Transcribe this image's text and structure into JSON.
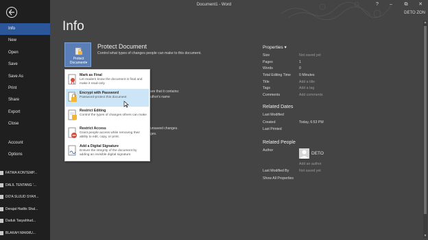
{
  "window": {
    "title": "Document1 - Word",
    "user": "DETO ZON",
    "controls": {
      "help": "?",
      "minimize": "–",
      "restore": "⧉",
      "close": "✕"
    }
  },
  "sidebar": {
    "items": [
      {
        "label": "Info"
      },
      {
        "label": "New"
      },
      {
        "label": "Open"
      },
      {
        "label": "Save"
      },
      {
        "label": "Save As"
      },
      {
        "label": "Print"
      },
      {
        "label": "Share"
      },
      {
        "label": "Export"
      },
      {
        "label": "Close"
      },
      {
        "label": "Account"
      },
      {
        "label": "Options"
      }
    ],
    "recent": [
      {
        "label": "FATWA KONTEMP..."
      },
      {
        "label": "DALIL TENTANG '..."
      },
      {
        "label": "DO'A SUJUD SYAH..."
      },
      {
        "label": "Derajat Hadits Shal..."
      },
      {
        "label": "Duduk Tasyahhud..."
      },
      {
        "label": "BLAKAH MAKMU..."
      }
    ]
  },
  "main": {
    "title": "Info",
    "protect": {
      "button_line1": "Protect",
      "button_line2": "Document",
      "caret": "▾",
      "title": "Protect Document",
      "description": "Control what types of changes people can make to this document."
    },
    "menu": [
      {
        "title": "Mark as Final",
        "desc": "Let readers know the document is final and make it read-only"
      },
      {
        "title": "Encrypt with Password",
        "desc": "Password-protect this document"
      },
      {
        "title": "Restrict Editing",
        "desc": "Control the types of changes others can make"
      },
      {
        "title": "Restrict Access",
        "desc": "Grant people access while removing their ability to edit, copy, or print."
      },
      {
        "title": "Add a Digital Signature",
        "desc": "Ensure the integrity of the document by adding an invisible digital signature"
      }
    ],
    "behind_texts": {
      "line1": "are that it contains:",
      "line2": "uthor's name",
      "line3": "unsaved changes.",
      "line4": "ges."
    }
  },
  "properties": {
    "header": "Properties",
    "header_caret": "▾",
    "rows": [
      {
        "label": "Size",
        "value": "Not saved yet",
        "muted": true
      },
      {
        "label": "Pages",
        "value": "1",
        "muted": false
      },
      {
        "label": "Words",
        "value": "0",
        "muted": false
      },
      {
        "label": "Total Editing Time",
        "value": "0 Minutes",
        "muted": false
      },
      {
        "label": "Title",
        "value": "Add a title",
        "muted": true
      },
      {
        "label": "Tags",
        "value": "Add a tag",
        "muted": true
      },
      {
        "label": "Comments",
        "value": "Add comments",
        "muted": true
      }
    ],
    "related_dates": {
      "title": "Related Dates",
      "last_modified_label": "Last Modified",
      "last_modified_value": "",
      "created_label": "Created",
      "created_value": "Today, 6:53 PM",
      "last_printed_label": "Last Printed",
      "last_printed_value": ""
    },
    "related_people": {
      "title": "Related People",
      "author_label": "Author",
      "author_name": "DETO",
      "add_author": "Add an author",
      "last_modified_by_label": "Last Modified By",
      "last_modified_by_value": "Not saved yet",
      "show_all": "Show All Properties"
    }
  },
  "colors": {
    "background": "#444444",
    "sidebar": "#1f1f1f",
    "active": "#2b579a",
    "menu_hover": "#cde6f7"
  }
}
